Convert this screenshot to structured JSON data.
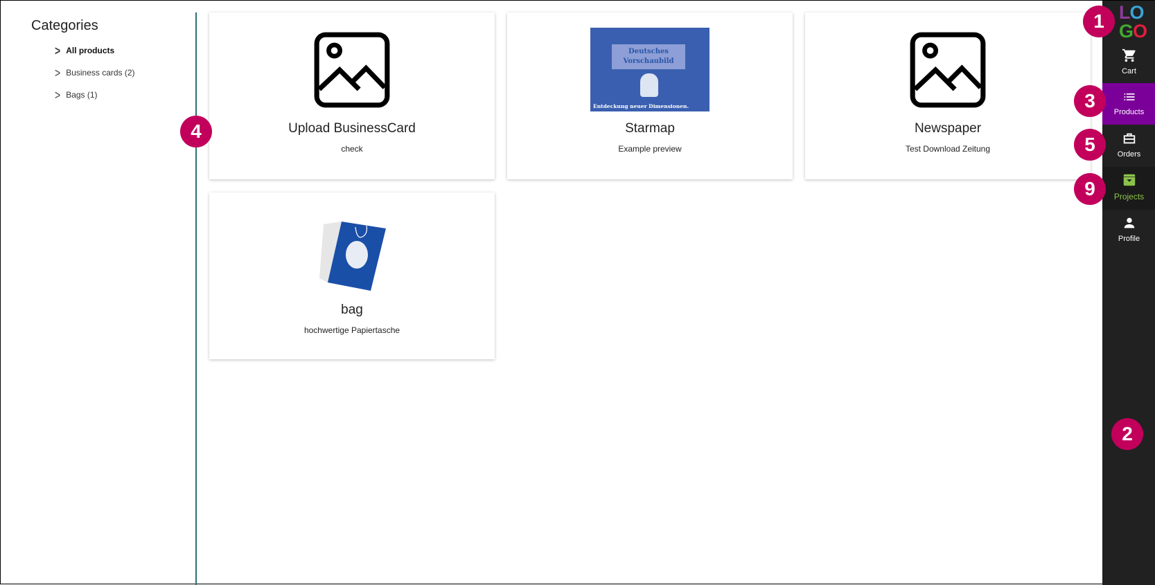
{
  "categories": {
    "title": "Categories",
    "items": [
      {
        "label": "All products",
        "active": true
      },
      {
        "label": "Business cards (2)"
      },
      {
        "label": "Bags (1)"
      }
    ]
  },
  "products": [
    {
      "title": "Upload BusinessCard",
      "subtitle": "check",
      "image": "image-placeholder-icon"
    },
    {
      "title": "Starmap",
      "subtitle": "Example preview",
      "image": "starmap-preview",
      "image_text": [
        "Deutsches",
        "Vorschaubild",
        "Entdeckung neuer Dimensionen."
      ]
    },
    {
      "title": "Newspaper",
      "subtitle": "Test Download Zeitung",
      "image": "image-placeholder-icon"
    },
    {
      "title": "bag",
      "subtitle": "hochwertige Papiertasche",
      "image": "bag-photo"
    }
  ],
  "sidebar": {
    "logo": "LOGO",
    "items": [
      {
        "label": "Cart",
        "icon": "cart-icon"
      },
      {
        "label": "Products",
        "icon": "list-icon",
        "active": true
      },
      {
        "label": "Orders",
        "icon": "briefcase-icon"
      },
      {
        "label": "Projects",
        "icon": "archive-icon"
      },
      {
        "label": "Profile",
        "icon": "person-icon"
      }
    ]
  },
  "badges": [
    "1",
    "2",
    "3",
    "4",
    "5",
    "9"
  ],
  "colors": {
    "sidebar_bg": "#212121",
    "active_bg": "#7b0099",
    "projects_green": "#8bc34a",
    "badge": "#c2005c",
    "divider": "#2c6f77"
  }
}
